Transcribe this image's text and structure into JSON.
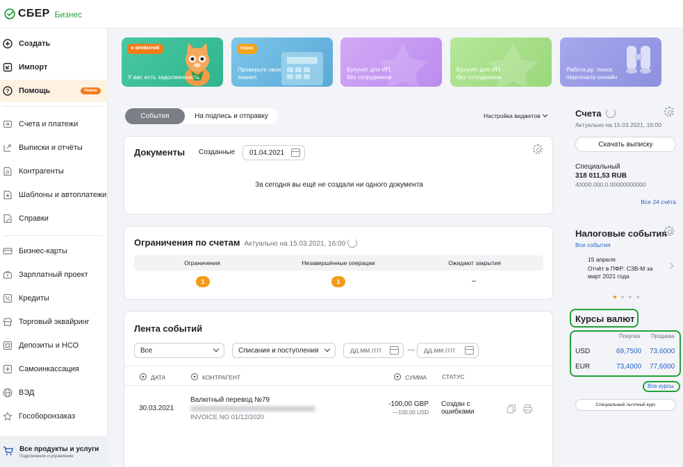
{
  "header": {
    "brand": "СБЕР",
    "brand_sub": "Бизнес"
  },
  "sidebar": {
    "items": [
      {
        "label": "Создать",
        "icon": "plus-circle-icon"
      },
      {
        "label": "Импорт",
        "icon": "import-icon"
      },
      {
        "label": "Помощь",
        "icon": "help-icon",
        "badge": "Новое"
      },
      {
        "label": "Счета и платежи",
        "icon": "payments-icon"
      },
      {
        "label": "Выписки и отчёты",
        "icon": "statements-icon"
      },
      {
        "label": "Контрагенты",
        "icon": "counterparties-icon"
      },
      {
        "label": "Шаблоны и автоплатежи",
        "icon": "templates-icon"
      },
      {
        "label": "Справки",
        "icon": "certificates-icon"
      },
      {
        "label": "Бизнес-карты",
        "icon": "card-icon"
      },
      {
        "label": "Зарплатный проект",
        "icon": "salary-icon"
      },
      {
        "label": "Кредиты",
        "icon": "credit-icon"
      },
      {
        "label": "Торговый эквайринг",
        "icon": "acquiring-icon"
      },
      {
        "label": "Депозиты и НСО",
        "icon": "deposit-icon"
      },
      {
        "label": "Самоинкассация",
        "icon": "cash-icon"
      },
      {
        "label": "ВЭД",
        "icon": "globe-icon"
      },
      {
        "label": "Гособоронзаказ",
        "icon": "star-icon"
      }
    ],
    "footer_title": "Все продукты и услуги",
    "footer_sub": "Подключение и управление"
  },
  "promos": [
    {
      "tag": "★ ВНИМАНИЕ",
      "text": "У вас есть задолженность",
      "color": "#3ec49a"
    },
    {
      "tag": "Опрос",
      "text": "Проверьте свои знания",
      "color": "#6bb8de"
    },
    {
      "tag": "",
      "text": "Бухучёт для ИП без сотрудников",
      "color": "#c79cf2"
    },
    {
      "tag": "",
      "text": "Бухучёт для ИП без сотрудников",
      "color": "#a9e08a"
    },
    {
      "tag": "",
      "text": "Работа.ру: поиск персонала онлайн",
      "color": "#9d9fe6"
    }
  ],
  "tabs": {
    "events": "События",
    "sign": "На подпись и отправку"
  },
  "widget_settings": "Настройка виджетов",
  "documents": {
    "title": "Документы",
    "filter_label": "Созданные",
    "date": "01.04.2021",
    "empty": "За сегодня вы ещё не создали ни одного документа"
  },
  "restrictions": {
    "title": "Ограничения по счетам",
    "updated": "Актуально на 15.03.2021, 16:00",
    "cols": [
      "Ограничения",
      "Незавершённые операции",
      "Ожидают закрытия"
    ],
    "values": [
      "1",
      "1",
      "–"
    ]
  },
  "feed": {
    "title": "Лента событий",
    "filter_all": "Все",
    "filter_type": "Списания и поступления",
    "date_placeholder": "дд.мм.гггг",
    "dash": "—",
    "cols": [
      "ДАТА",
      "КОНТРАГЕНТ",
      "СУММА",
      "СТАТУС"
    ],
    "row": {
      "date": "30.03.2021",
      "name": "Валютный перевод №79",
      "ref": "INVOICE NO 01/12/2020",
      "amount": "-100,00 GBP",
      "amount_sub": "—100,00 USD",
      "status": "Создан с ошибками"
    }
  },
  "accounts": {
    "title": "Счета",
    "updated": "Актуально на 15.03.2021, 16:00",
    "download": "Скачать выписку",
    "acc_name": "Специальный",
    "acc_balance": "318 011,53 RUB",
    "acc_number": "40000.000.0.00000000000",
    "all": "Все 24 счёта"
  },
  "tax": {
    "title": "Налоговые события",
    "all": "Все события",
    "date": "15 апреля",
    "text": "Отчёт в ПФР: СЗВ-М за март 2021 года"
  },
  "fx": {
    "title": "Курсы валют",
    "buy": "Покупка",
    "sell": "Продажа",
    "rows": [
      {
        "cur": "USD",
        "buy": "69,7500",
        "sell": "73,6000"
      },
      {
        "cur": "EUR",
        "buy": "73,4000",
        "sell": "77,6000"
      }
    ],
    "all": "Все курсы",
    "special": "Специальный льготный курс"
  }
}
